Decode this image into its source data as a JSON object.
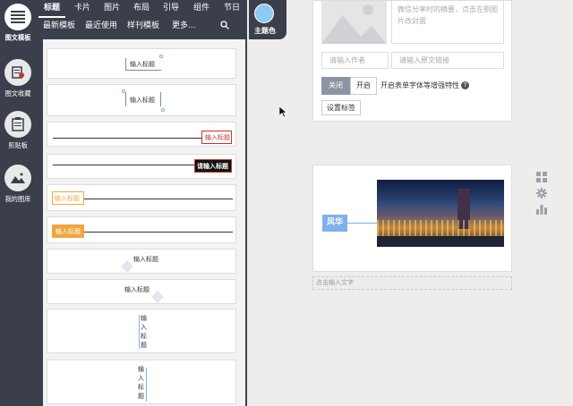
{
  "sidebar": {
    "items": [
      {
        "label": "图文模板",
        "icon": "menu-list-icon"
      },
      {
        "label": "图文收藏",
        "icon": "collection-icon"
      },
      {
        "label": "剪贴板",
        "icon": "clipboard-icon"
      },
      {
        "label": "我的图库",
        "icon": "gallery-icon"
      }
    ]
  },
  "top_tabs": [
    "标题",
    "卡片",
    "图片",
    "布局",
    "引导",
    "组件",
    "节日"
  ],
  "sub_tabs": [
    "最新模板",
    "最近使用",
    "样刊模板",
    "更多..."
  ],
  "theme": {
    "label": "主题色",
    "color": "#8fcaf0"
  },
  "templates": [
    {
      "label": "输入标题"
    },
    {
      "label": "输入标题"
    },
    {
      "label": "输入标题"
    },
    {
      "label": "请输入标题"
    },
    {
      "label": "输入标题"
    },
    {
      "label": "输入标题"
    },
    {
      "label": "输入标题"
    },
    {
      "label": "输入标题"
    },
    {
      "label": "输入标题"
    },
    {
      "label": "输入标题"
    }
  ],
  "editor": {
    "summary_placeholder": "微信分享时的摘要，点击左侧图片改封面",
    "author_placeholder": "请输入作者",
    "source_placeholder": "请输入原文链接",
    "toggle_off": "关闭",
    "toggle_on": "开启",
    "toggle_label": "开启表单字体等增强特性",
    "help_icon": "?",
    "tag_button": "设置标签",
    "block_label": "风华",
    "caption_placeholder": "点击输入文字"
  },
  "colors": {
    "dark": "#3a3f4b",
    "accent_blue": "#7fb1ea",
    "label_red": "#c0392b",
    "label_orange": "#f0a640"
  }
}
